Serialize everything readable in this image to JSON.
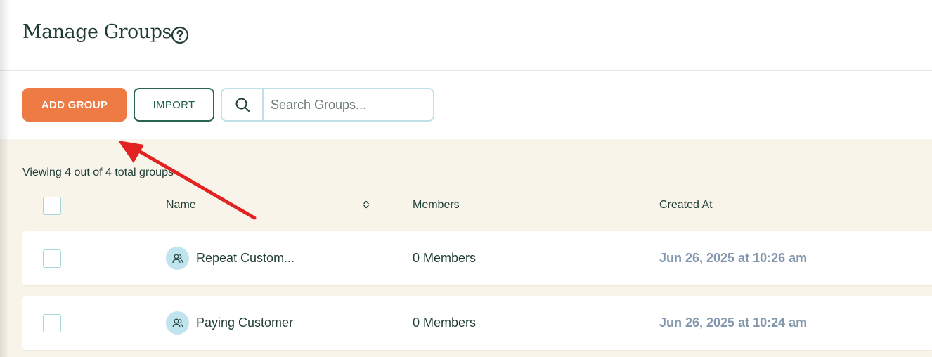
{
  "header": {
    "title": "Manage Groups",
    "help_icon": "question-circle-icon"
  },
  "toolbar": {
    "add_label": "ADD GROUP",
    "import_label": "IMPORT",
    "search_placeholder": "Search Groups...",
    "search_icon": "search-icon"
  },
  "summary": {
    "viewing_text": "Viewing 4 out of 4 total groups"
  },
  "table": {
    "columns": [
      "Name",
      "Members",
      "Created At"
    ],
    "rows": [
      {
        "name": "Repeat Custom...",
        "members": "0 Members",
        "created_at": "Jun 26, 2025 at 10:26 am"
      },
      {
        "name": "Paying Customer",
        "members": "0 Members",
        "created_at": "Jun 26, 2025 at 10:24 am"
      }
    ]
  },
  "annotation": {
    "arrow_color": "#e32222"
  },
  "colors": {
    "accent": "#ee7a44",
    "primary_dark": "#1f3d36",
    "teal_border": "#bfe1e5",
    "content_bg": "#f8f4ea",
    "date_text": "#8296ad"
  }
}
